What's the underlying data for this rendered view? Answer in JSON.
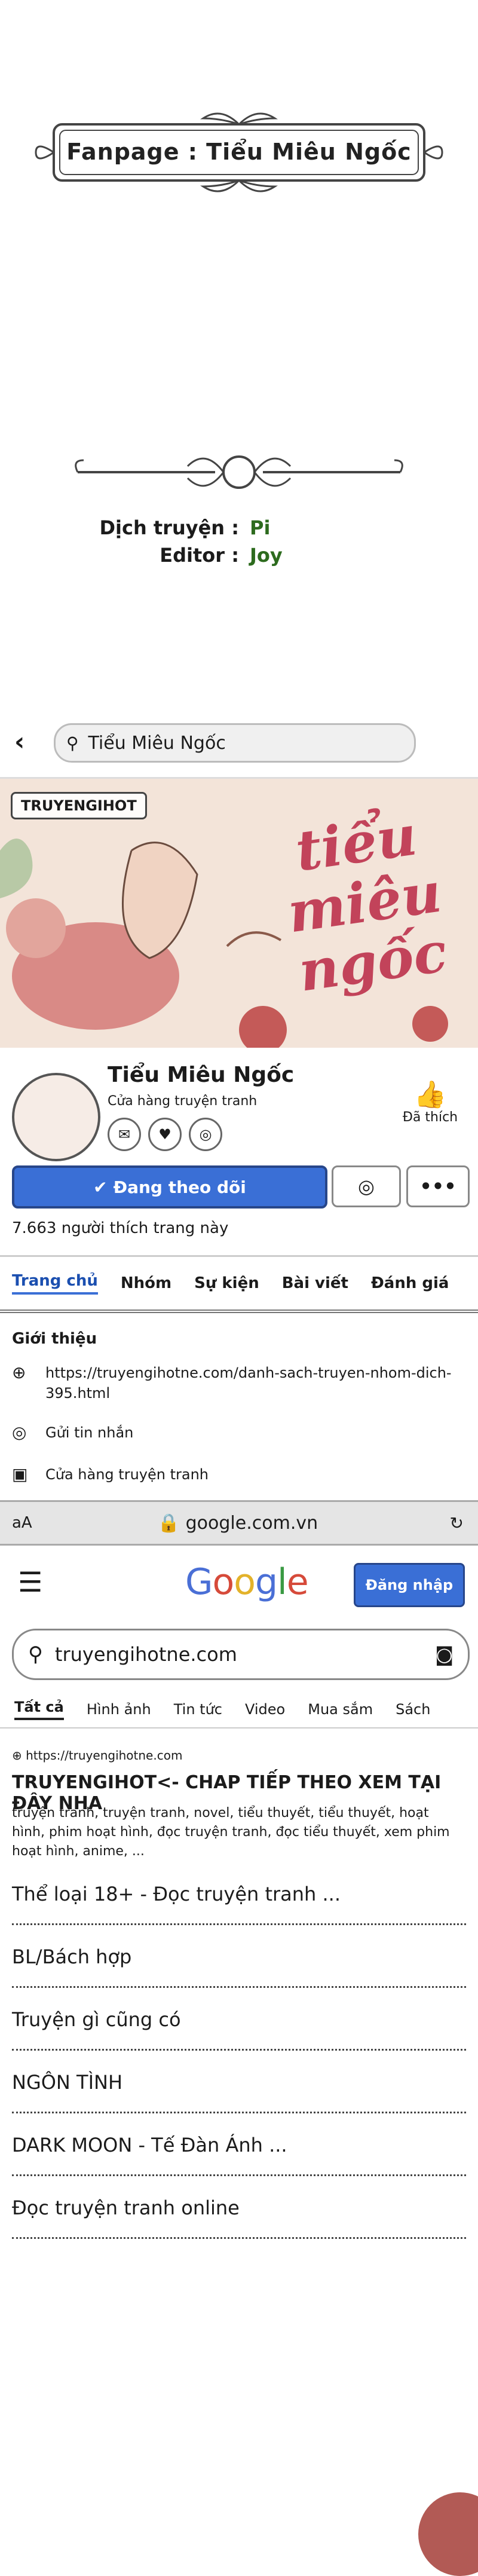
{
  "header": {
    "fanpage_label": "Fanpage : Tiểu Miêu Ngốc"
  },
  "credits": {
    "translator_key": "Dịch truyện :",
    "translator_value": "Pi",
    "editor_key": "Editor :",
    "editor_value": "Joy"
  },
  "facebook": {
    "search_query": "Tiểu Miêu Ngốc",
    "cover_tag": "TRUYENGIHOT",
    "cover_title": "tiểu miêu ngốc",
    "page_name": "Tiểu Miêu Ngốc",
    "page_category": "Cửa hàng truyện tranh",
    "liked_label": "Đã thích",
    "follow_button": "Đang theo dõi",
    "likes_count": "7.663 người thích trang này",
    "tabs": [
      "Trang chủ",
      "Nhóm",
      "Sự kiện",
      "Bài viết",
      "Đánh giá"
    ],
    "intro_title": "Giới thiệu",
    "intro_items": [
      {
        "icon": "link-icon",
        "text": "https://truyengihotne.com/danh-sach-truyen-nhom-dich-395.html"
      },
      {
        "icon": "messenger-icon",
        "text": "Gửi tin nhắn"
      },
      {
        "icon": "shop-icon",
        "text": "Cửa hàng truyện tranh"
      }
    ],
    "browser_left": "aA",
    "browser_url": "google.com.vn"
  },
  "google": {
    "logo": [
      "G",
      "o",
      "o",
      "g",
      "l",
      "e"
    ],
    "signin_button": "Đăng nhập",
    "search_query": "truyengihotne.com",
    "tabs": [
      "Tất cả",
      "Hình ảnh",
      "Tin tức",
      "Video",
      "Mua sắm",
      "Sách"
    ],
    "result_url": "https://truyengihotne.com",
    "result_title": "TRUYENGIHOT<- CHAP TIẾP THEO XEM TẠI ĐÂY NHA",
    "result_snippet": "truyện tranh, truyện tranh, novel, tiểu thuyết, tiểu thuyết, hoạt hình, phim hoạt hình, đọc truyện tranh, đọc tiểu thuyết, xem phim hoạt hình, anime, ...",
    "links": [
      "Thể loại 18+ - Đọc truyện tranh ...",
      "BL/Bách hợp",
      "Truyện gì cũng có",
      "NGÔN TÌNH",
      "DARK MOON - Tế Đàn Ánh ...",
      "Đọc truyện tranh online"
    ]
  }
}
